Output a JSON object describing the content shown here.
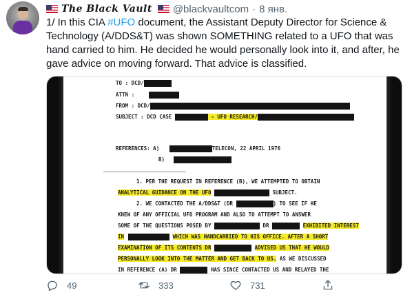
{
  "tweet": {
    "display_name": "The Black Vault",
    "handle": "@blackvaultcom",
    "separator": "·",
    "date": "8 янв.",
    "text": {
      "prefix": "1/ In this CIA ",
      "hashtag": "#UFO",
      "suffix": " document, the Assistant Deputy Director for Science & Technology (A/DDS&T) was shown SOMETHING related to a UFO that was hand carried to him. He decided he would personally look into it, and after, he gave advice on moving forward. That advice is classified."
    }
  },
  "document": {
    "lines": {
      "to": "TO      :  DCD/",
      "attn": "ATTN    :",
      "from": "FROM    :  DCD/",
      "subject_a": "SUBJECT :  DCD CASE",
      "subject_b": " - UFO RESEARCH/",
      "ref_a_label": "REFERENCES:  A)",
      "ref_a_value": "TELECON, 22 APRIL 1976",
      "ref_b_label": "B)",
      "p1_a": "1.  PER THE REQUEST IN REFERENCE (B), WE ATTEMPTED TO OBTAIN",
      "p1_b": "ANALYTICAL GUIDANCE ON THE UFO",
      "p1_c": "SUBJECT.",
      "p2_a": "2.  WE CONTACTED THE A/DDS&T (DR",
      "p2_b": ") TO SEE IF HE",
      "p2_c": "KNEW OF ANY OFFICIAL UFO PROGRAM AND ALSO TO ATTEMPT TO ANSWER",
      "p2_d": "SOME OF THE QUESTIONS POSED BY",
      "p2_e": "DR",
      "p2_f": "EXHIBITED INTEREST",
      "p2_g": "IN",
      "p2_h": "WHICH WAS HANDCARRIED TO HIS OFFICE.  AFTER A SHORT",
      "p2_i": "EXAMINATION OF ITS CONTENTS DR",
      "p2_j": "ADVISED US THAT HE WOULD",
      "p2_k": "PERSONALLY LOOK INTO THE MATTER AND GET BACK TO US.",
      "p2_l": "AS WE DISCUSSED",
      "p2_m": "IN REFERENCE (A) DR",
      "p2_n": "HAS SINCE CONTACTED US AND RELAYED THE"
    }
  },
  "actions": {
    "replies": "49",
    "retweets": "333",
    "likes": "731"
  },
  "colors": {
    "hashtag": "#1d9bf0",
    "highlight": "#f5ea2a",
    "secondary_text": "#536471"
  },
  "icons": [
    "reply-icon",
    "retweet-icon",
    "like-icon",
    "share-icon",
    "us-flag-icon"
  ]
}
